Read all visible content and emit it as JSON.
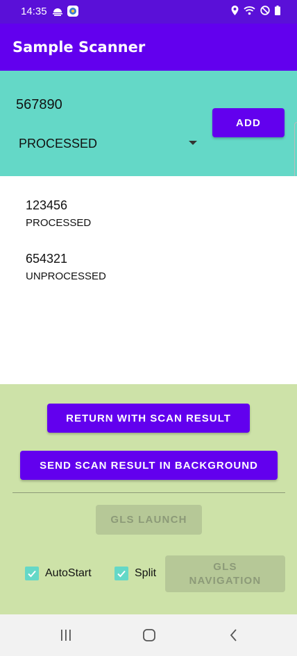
{
  "status_bar": {
    "time": "14:35",
    "left_icons": [
      "weather-icon",
      "app-notification-icon"
    ],
    "right_icons": [
      "location-icon",
      "wifi-icon",
      "do-not-disturb-icon",
      "battery-icon"
    ]
  },
  "app_bar": {
    "title": "Sample Scanner"
  },
  "input_panel": {
    "code_value": "567890",
    "status_selected": "PROCESSED",
    "add_label": "ADD"
  },
  "results": [
    {
      "code": "123456",
      "status": "PROCESSED"
    },
    {
      "code": "654321",
      "status": "UNPROCESSED"
    }
  ],
  "actions": {
    "return_label": "RETURN WITH SCAN RESULT",
    "send_label": "SEND SCAN RESULT IN BACKGROUND",
    "gls_launch_label": "GLS LAUNCH",
    "autostart_label": "AutoStart",
    "autostart_checked": true,
    "split_label": "Split",
    "split_checked": true,
    "gls_navigation_label": "GLS NAVIGATION"
  },
  "nav_bar": {
    "icons": [
      "recent-apps-icon",
      "home-icon",
      "back-icon"
    ]
  },
  "colors": {
    "primary": "#6200ee",
    "status_bar": "#5a10d8",
    "input_panel": "#64d8c7",
    "actions_panel": "#cde2a8",
    "checkbox": "#64d8c7"
  }
}
